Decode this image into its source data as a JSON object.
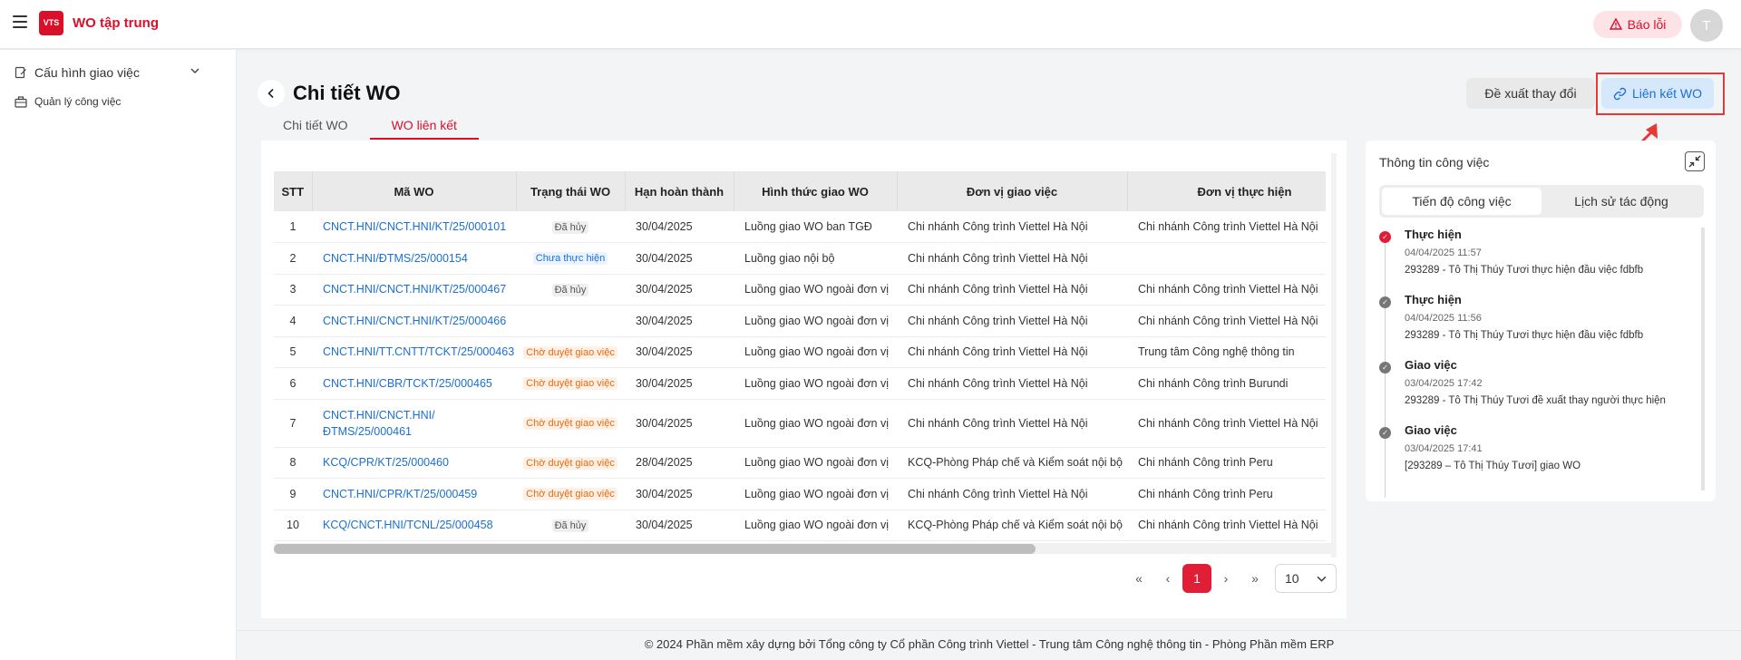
{
  "app": {
    "title": "WO tập trung",
    "logo_text": "VTS"
  },
  "header": {
    "report_label": "Báo lỗi",
    "avatar_initial": "T"
  },
  "sidebar": {
    "group_label": "Cấu hình giao việc",
    "items": [
      {
        "label": "Quản lý công việc"
      }
    ]
  },
  "page": {
    "title": "Chi tiết WO",
    "tabs": [
      {
        "label": "Chi tiết WO"
      },
      {
        "label": "WO liên kết"
      }
    ],
    "active_tab": "WO liên kết",
    "actions": {
      "propose_label": "Đề xuất thay đổi",
      "link_label": "Liên kết WO"
    }
  },
  "table": {
    "columns": [
      "STT",
      "Mã WO",
      "Trạng thái WO",
      "Hạn hoàn thành",
      "Hình thức giao WO",
      "Đơn vị giao việc",
      "Đơn vị thực hiện"
    ],
    "rows": [
      {
        "stt": "1",
        "code": "CNCT.HNI/CNCT.HNI/KT/25/000101",
        "status": "Đã hủy",
        "due": "30/04/2025",
        "type": "Luồng giao WO ban TGĐ",
        "assigner": "Chi nhánh Công trình Viettel Hà Nội",
        "executor": "Chi nhánh Công trình Viettel Hà Nội"
      },
      {
        "stt": "2",
        "code": "CNCT.HNI/ĐTMS/25/000154",
        "status": "Chưa thực hiện",
        "due": "30/04/2025",
        "type": "Luồng giao nội bộ",
        "assigner": "Chi nhánh Công trình Viettel Hà Nội",
        "executor": ""
      },
      {
        "stt": "3",
        "code": "CNCT.HNI/CNCT.HNI/KT/25/000467",
        "status": "Đã hủy",
        "due": "30/04/2025",
        "type": "Luồng giao WO ngoài đơn vị",
        "assigner": "Chi nhánh Công trình Viettel Hà Nội",
        "executor": "Chi nhánh Công trình Viettel Hà Nội"
      },
      {
        "stt": "4",
        "code": "CNCT.HNI/CNCT.HNI/KT/25/000466",
        "status": "",
        "due": "30/04/2025",
        "type": "Luồng giao WO ngoài đơn vị",
        "assigner": "Chi nhánh Công trình Viettel Hà Nội",
        "executor": "Chi nhánh Công trình Viettel Hà Nội"
      },
      {
        "stt": "5",
        "code": "CNCT.HNI/TT.CNTT/TCKT/25/000463",
        "status": "Chờ duyệt giao việc",
        "due": "30/04/2025",
        "type": "Luồng giao WO ngoài đơn vị",
        "assigner": "Chi nhánh Công trình Viettel Hà Nội",
        "executor": "Trung tâm Công nghệ thông tin"
      },
      {
        "stt": "6",
        "code": "CNCT.HNI/CBR/TCKT/25/000465",
        "status": "Chờ duyệt giao việc",
        "due": "30/04/2025",
        "type": "Luồng giao WO ngoài đơn vị",
        "assigner": "Chi nhánh Công trình Viettel Hà Nội",
        "executor": "Chi nhánh Công trình Burundi"
      },
      {
        "stt": "7",
        "code": "CNCT.HNI/CNCT.HNI/ ĐTMS/25/000461",
        "status": "Chờ duyệt giao việc",
        "due": "30/04/2025",
        "type": "Luồng giao WO ngoài đơn vị",
        "assigner": "Chi nhánh Công trình Viettel Hà Nội",
        "executor": "Chi nhánh Công trình Viettel Hà Nội"
      },
      {
        "stt": "8",
        "code": "KCQ/CPR/KT/25/000460",
        "status": "Chờ duyệt giao việc",
        "due": "28/04/2025",
        "type": "Luồng giao WO ngoài đơn vị",
        "assigner": "KCQ-Phòng Pháp chế và Kiểm soát nội bộ",
        "executor": "Chi nhánh Công trình Peru"
      },
      {
        "stt": "9",
        "code": "CNCT.HNI/CPR/KT/25/000459",
        "status": "Chờ duyệt giao việc",
        "due": "30/04/2025",
        "type": "Luồng giao WO ngoài đơn vị",
        "assigner": "Chi nhánh Công trình Viettel Hà Nội",
        "executor": "Chi nhánh Công trình Peru"
      },
      {
        "stt": "10",
        "code": "KCQ/CNCT.HNI/TCNL/25/000458",
        "status": "Đã hủy",
        "due": "30/04/2025",
        "type": "Luồng giao WO ngoài đơn vị",
        "assigner": "KCQ-Phòng Pháp chế và Kiểm soát nội bộ",
        "executor": "Chi nhánh Công trình Viettel Hà Nội"
      }
    ]
  },
  "pagination": {
    "first": "«",
    "prev": "‹",
    "current": "1",
    "next": "›",
    "last": "»",
    "page_size": "10"
  },
  "panel": {
    "title": "Thông tin công việc",
    "tabs": [
      {
        "label": "Tiến độ công việc"
      },
      {
        "label": "Lịch sử tác động"
      }
    ],
    "timeline": [
      {
        "status": "Thực hiện",
        "time": "04/04/2025 11:57",
        "desc": "293289 - Tô Thị Thúy Tươi thực hiện đầu việc fdbfb"
      },
      {
        "status": "Thực hiện",
        "time": "04/04/2025 11:56",
        "desc": "293289 - Tô Thị Thúy Tươi thực hiện đầu việc fdbfb"
      },
      {
        "status": "Giao việc",
        "time": "03/04/2025 17:42",
        "desc": "293289 - Tô Thị Thúy Tươi đề xuất thay người thực hiện"
      },
      {
        "status": "Giao việc",
        "time": "03/04/2025 17:41",
        "desc": "[293289 – Tô Thị Thúy Tươi] giao WO"
      }
    ]
  },
  "footer": {
    "text": "© 2024 Phần mềm xây dựng bởi Tổng công ty Cổ phần Công trình Viettel - Trung tâm Công nghệ thông tin - Phòng Phần mềm ERP"
  },
  "colors": {
    "brand": "#d9102a",
    "link": "#1a6fd1",
    "annotation": "#e53935"
  }
}
